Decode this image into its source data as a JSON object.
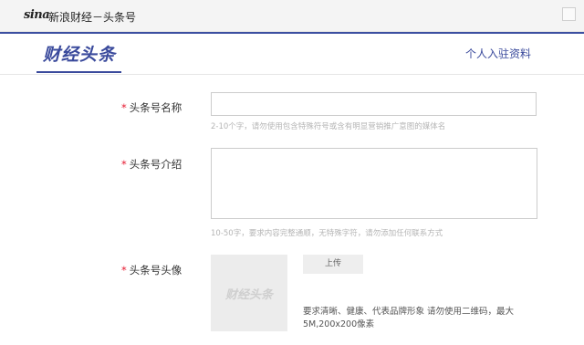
{
  "topbar": {
    "logo": "sina",
    "site_title": "新浪财经－头条号"
  },
  "header": {
    "brand": "财经头条",
    "link": "个人入驻资料"
  },
  "form": {
    "name": {
      "required": "*",
      "label": "头条号名称",
      "value": "",
      "hint": "2-10个字，请勿使用包含特殊符号或含有明显营销推广意图的媒体名"
    },
    "intro": {
      "required": "*",
      "label": "头条号介绍",
      "value": "",
      "hint": "10-50字，要求内容完整通顺，无特殊字符，请勿添加任何联系方式"
    },
    "avatar": {
      "required": "*",
      "label": "头条号头像",
      "placeholder_text": "财经头条",
      "upload_label": "上传",
      "note_line1": "要求清晰、健康、代表品牌形象 请勿使用二维码，最大",
      "note_line2": "5M,200x200像素"
    }
  },
  "colors": {
    "accent": "#3a4a9c",
    "required": "#e6162d"
  }
}
